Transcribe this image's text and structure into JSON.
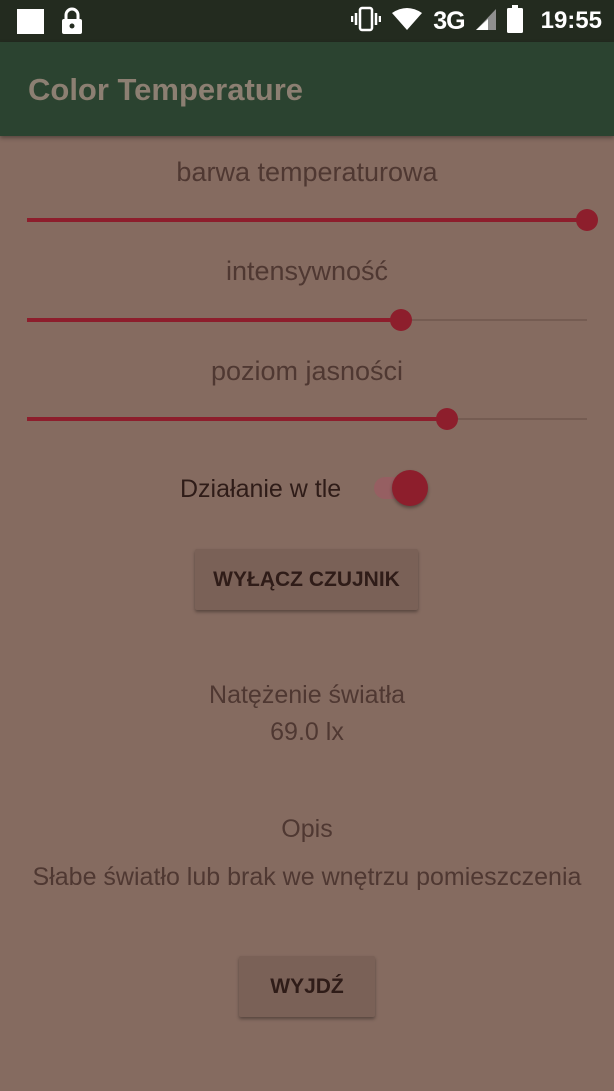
{
  "status_bar": {
    "network": "3G",
    "time": "19:55",
    "icons": [
      "notification-square-icon",
      "lock-icon",
      "vibrate-icon",
      "wifi-icon",
      "signal-icon",
      "battery-icon"
    ]
  },
  "app_bar": {
    "title": "Color Temperature"
  },
  "sliders": [
    {
      "label": "barwa temperaturowa",
      "value": 1.0
    },
    {
      "label": "intensywność",
      "value": 0.667
    },
    {
      "label": "poziom jasności",
      "value": 0.75
    }
  ],
  "background_switch": {
    "label": "Działanie w tle",
    "on": true
  },
  "sensor_button": {
    "label": "WYŁĄCZ CZUJNIK"
  },
  "light_intensity": {
    "label": "Natężenie światła",
    "value": "69.0 lx"
  },
  "description": {
    "label": "Opis",
    "text": "Słabe światło lub brak we wnętrzu pomieszczenia"
  },
  "exit_button": {
    "label": "WYJDŹ"
  },
  "colors": {
    "background": "#856b60",
    "app_bar": "#2b4330",
    "accent": "#8d1e2c",
    "status_bar": "#232b1f"
  }
}
